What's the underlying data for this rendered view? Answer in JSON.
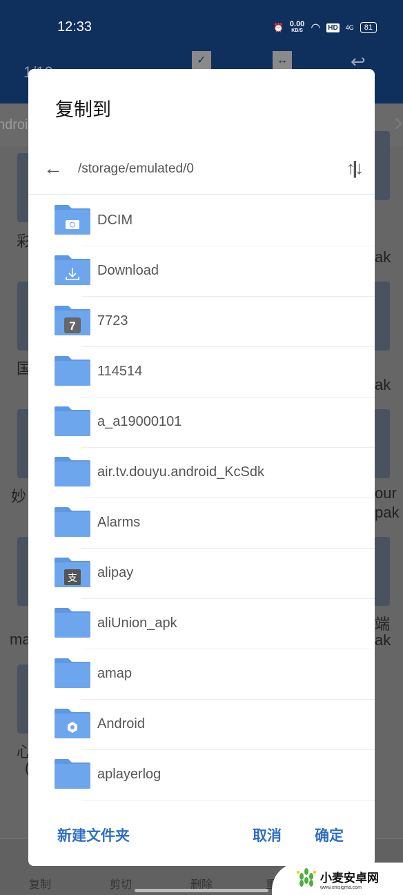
{
  "status_bar": {
    "time": "12:33",
    "net_speed": "0.00",
    "net_unit": "KB/S",
    "hd": "HD",
    "signal": "4G",
    "battery": "81"
  },
  "background": {
    "count": "1/10",
    "breadcrumb": "ndroid",
    "left_labels": [
      "彩",
      "国",
      "妙",
      "ma",
      "心",
      "("
    ],
    "right_labels": [
      "ak",
      "ak",
      "our",
      "pak",
      "端",
      "ak"
    ],
    "bottom_actions": [
      "复制",
      "剪切",
      "删除",
      "重命名"
    ]
  },
  "dialog": {
    "title": "复制到",
    "path": "/storage/emulated/0",
    "folders": [
      {
        "name": "DCIM",
        "icon": "camera"
      },
      {
        "name": "Download",
        "icon": "download"
      },
      {
        "name": "7723",
        "icon": "7723-app"
      },
      {
        "name": "114514",
        "icon": "none"
      },
      {
        "name": "a_a19000101",
        "icon": "none"
      },
      {
        "name": "air.tv.douyu.android_KcSdk",
        "icon": "none"
      },
      {
        "name": "Alarms",
        "icon": "none"
      },
      {
        "name": "alipay",
        "icon": "alipay"
      },
      {
        "name": "aliUnion_apk",
        "icon": "none"
      },
      {
        "name": "amap",
        "icon": "none"
      },
      {
        "name": "Android",
        "icon": "gear"
      },
      {
        "name": "aplayerlog",
        "icon": "none"
      }
    ],
    "new_folder": "新建文件夹",
    "cancel": "取消",
    "confirm": "确定"
  },
  "watermark": {
    "name": "小麦安卓网",
    "url": "www.xmsigma.com"
  },
  "colors": {
    "accent": "#2f6fc4",
    "folder": "#6ea6ee",
    "topbar": "#0f2f5d"
  }
}
